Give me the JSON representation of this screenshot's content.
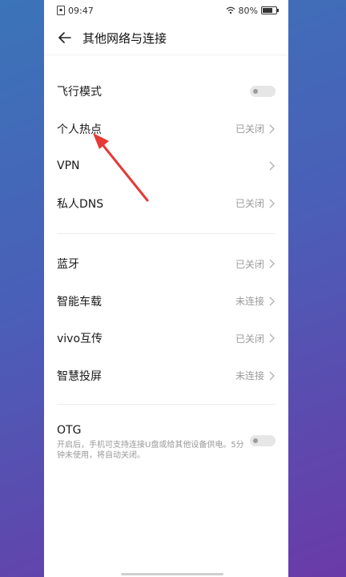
{
  "status": {
    "time": "09:47",
    "battery": "80%",
    "battery_level": 0.8
  },
  "header": {
    "title": "其他网络与连接"
  },
  "group1": [
    {
      "label": "飞行模式",
      "type": "toggle"
    },
    {
      "label": "个人热点",
      "value": "已关闭"
    },
    {
      "label": "VPN",
      "value": ""
    },
    {
      "label": "私人DNS",
      "value": "已关闭"
    }
  ],
  "group2": [
    {
      "label": "蓝牙",
      "value": "已关闭"
    },
    {
      "label": "智能车载",
      "value": "未连接"
    },
    {
      "label": "vivo互传",
      "value": "已关闭"
    },
    {
      "label": "智慧投屏",
      "value": "未连接"
    }
  ],
  "otg": {
    "title": "OTG",
    "desc": "开启后，手机可支持连接U盘或给其他设备供电。5分钟未使用，将自动关闭。"
  },
  "colors": {
    "annotation": "#e53935"
  }
}
